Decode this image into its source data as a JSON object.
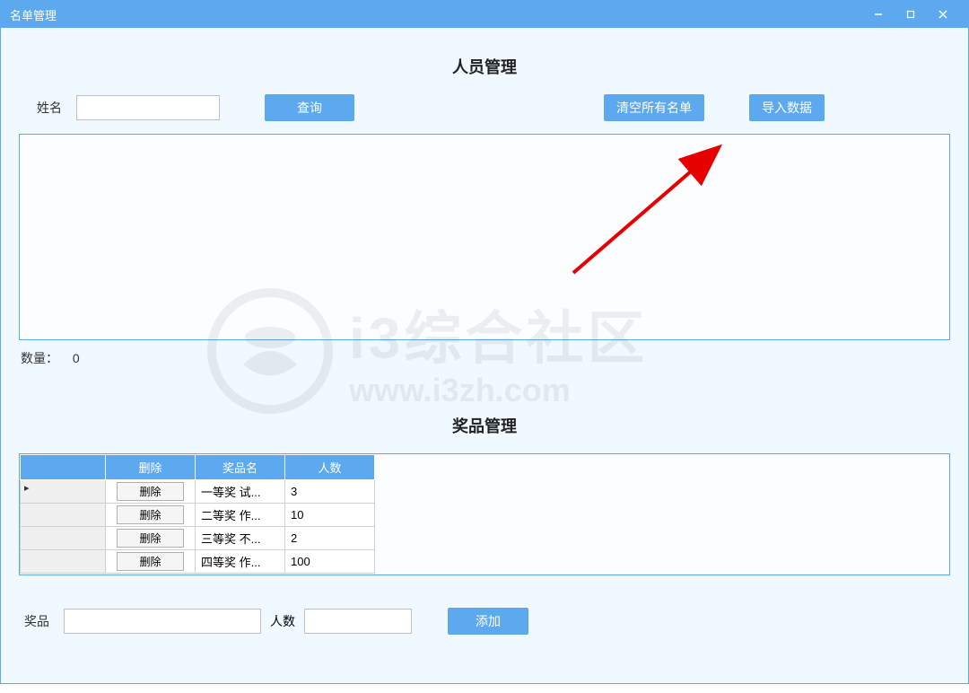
{
  "window": {
    "title": "名单管理"
  },
  "section1": {
    "title": "人员管理",
    "name_label": "姓名",
    "search_btn": "查询",
    "clear_btn": "清空所有名单",
    "import_btn": "导入数据",
    "count_label": "数量：",
    "count_value": "0"
  },
  "section2": {
    "title": "奖品管理",
    "headers": {
      "del": "删除",
      "name": "奖品名",
      "count": "人数"
    },
    "rows": [
      {
        "del": "删除",
        "name": "一等奖 试...",
        "count": "3"
      },
      {
        "del": "删除",
        "name": "二等奖 作...",
        "count": "10"
      },
      {
        "del": "删除",
        "name": "三等奖 不...",
        "count": "2"
      },
      {
        "del": "删除",
        "name": "四等奖 作...",
        "count": "100"
      }
    ],
    "prize_label": "奖品",
    "people_label": "人数",
    "add_btn": "添加"
  },
  "watermark": {
    "line1": "i3综合社区",
    "line2": "www.i3zh.com"
  }
}
